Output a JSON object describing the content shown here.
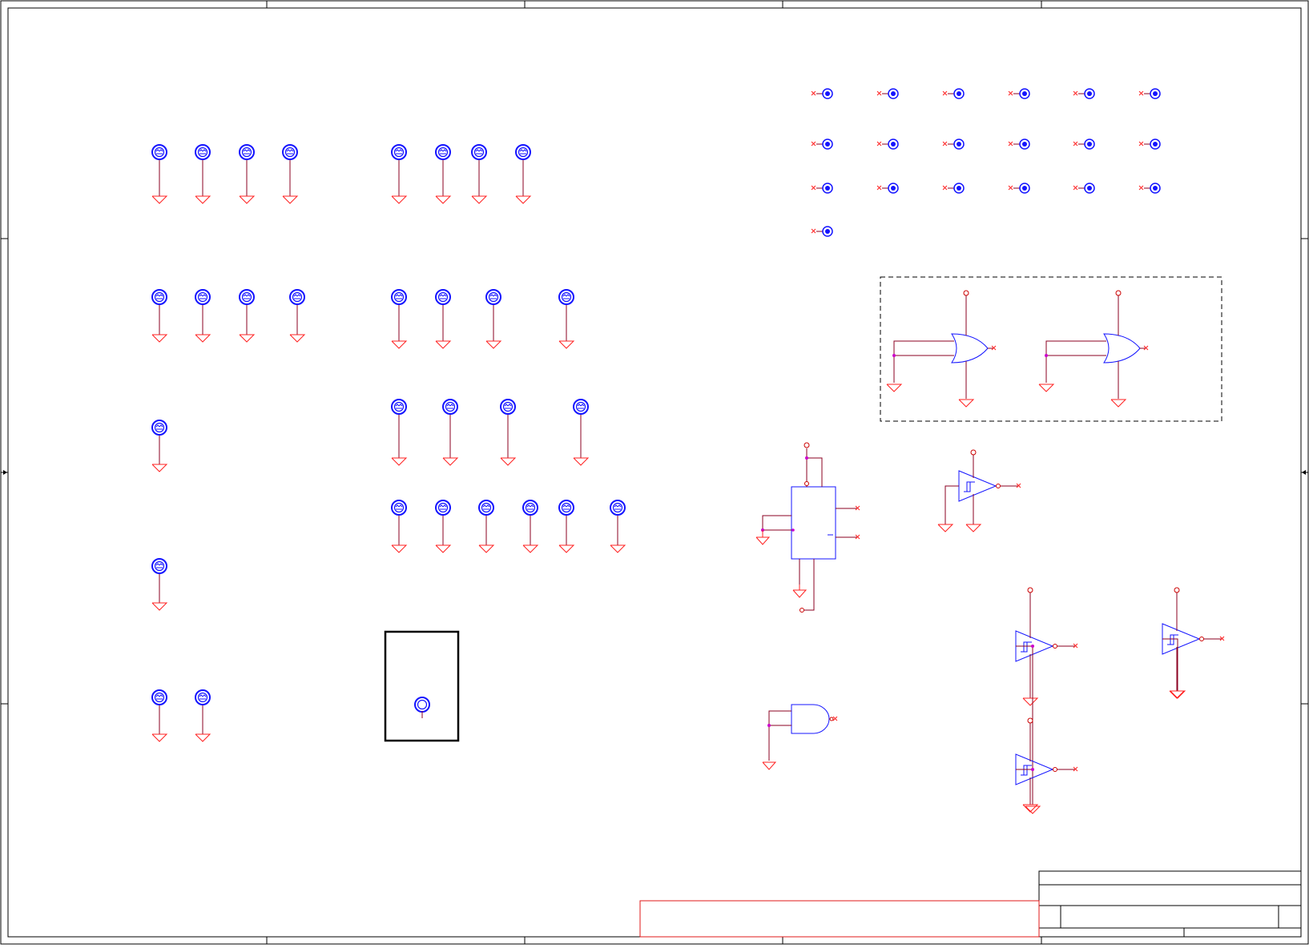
{
  "sheet": {
    "title_block_text": [],
    "zone_labels": []
  },
  "colors": {
    "border": "#000000",
    "wire": "#8b0020",
    "ground": "#ff2020",
    "component": "#1414ff",
    "junction": "#cc00cc",
    "dashed_box": "#000000",
    "notes_box": "#e01818"
  },
  "symbols": {
    "mounting_hole": "target-icon",
    "ground": "ground-icon",
    "test_point": "test-point-icon",
    "or_gate": "or-gate-icon",
    "and_gate": "and-gate-icon",
    "schmitt_buffer": "schmitt-trigger-icon",
    "flip_flop": "flip-flop-icon"
  }
}
